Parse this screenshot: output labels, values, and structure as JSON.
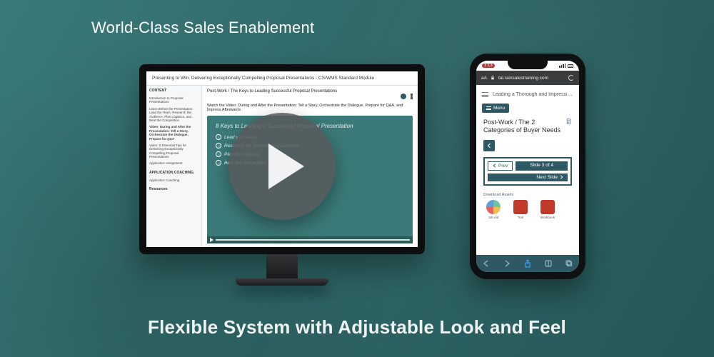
{
  "hero": {
    "title": "World-Class Sales Enablement",
    "tagline": "Flexible System with Adjustable Look and Feel"
  },
  "monitor": {
    "page_title": "Presenting to Win: Delivering Exceptionally Compelling Proposal Presentations - CS/WMS Standard Module",
    "sidebar": {
      "section1_header": "CONTENT",
      "items": [
        "Introduction to Proposal Presentations",
        "Learn Before the Presentation: Lead the Team, Research the Audience, Plan Logistics, and Beat the Competition",
        "Video: During and After the Presentation: Tell a Story, Orchestrate the Dialogue, Prepare for Q&A",
        "Video: 8 Essential Tips for Delivering Exceptionally Compelling Proposal Presentations",
        "Application Assignment"
      ],
      "section2_header": "APPLICATION COACHING",
      "section2_item": "Application Coaching",
      "resources_header": "Resources"
    },
    "breadcrumb": "Post-Work / The Keys to Leading Successful Proposal Presentations",
    "instruction": "Watch the Video: During and After the Presentation: Tell a Story, Orchestrate the Dialogue, Prepare for Q&A, and Impress Afterwards",
    "video": {
      "title": "8 Keys to Leading a Successful Proposal Presentation",
      "points": [
        {
          "n": "1",
          "t": "Lead your team"
        },
        {
          "n": "2",
          "t": "Research the presentation audience"
        },
        {
          "n": "3",
          "t": "Plan the logistics"
        },
        {
          "n": "4",
          "t": "Beat the competition"
        }
      ]
    }
  },
  "phone": {
    "status_time": "3:13",
    "url_bar": {
      "aa": "aA",
      "domain": "tal.rainsalestraining.com"
    },
    "header_title": "Leading a Thorough and Impressiv…",
    "menu_button": "Menu",
    "content_title": "Post-Work / The 2 Categories of Buyer Needs",
    "slide_nav": {
      "prev": "Prev",
      "count": "Slide 3 of 4",
      "next": "Next Slide"
    },
    "downloads_label": "Download Assets",
    "downloads": [
      {
        "label": "Job Aid"
      },
      {
        "label": "Tool"
      },
      {
        "label": "Workbook"
      }
    ]
  }
}
